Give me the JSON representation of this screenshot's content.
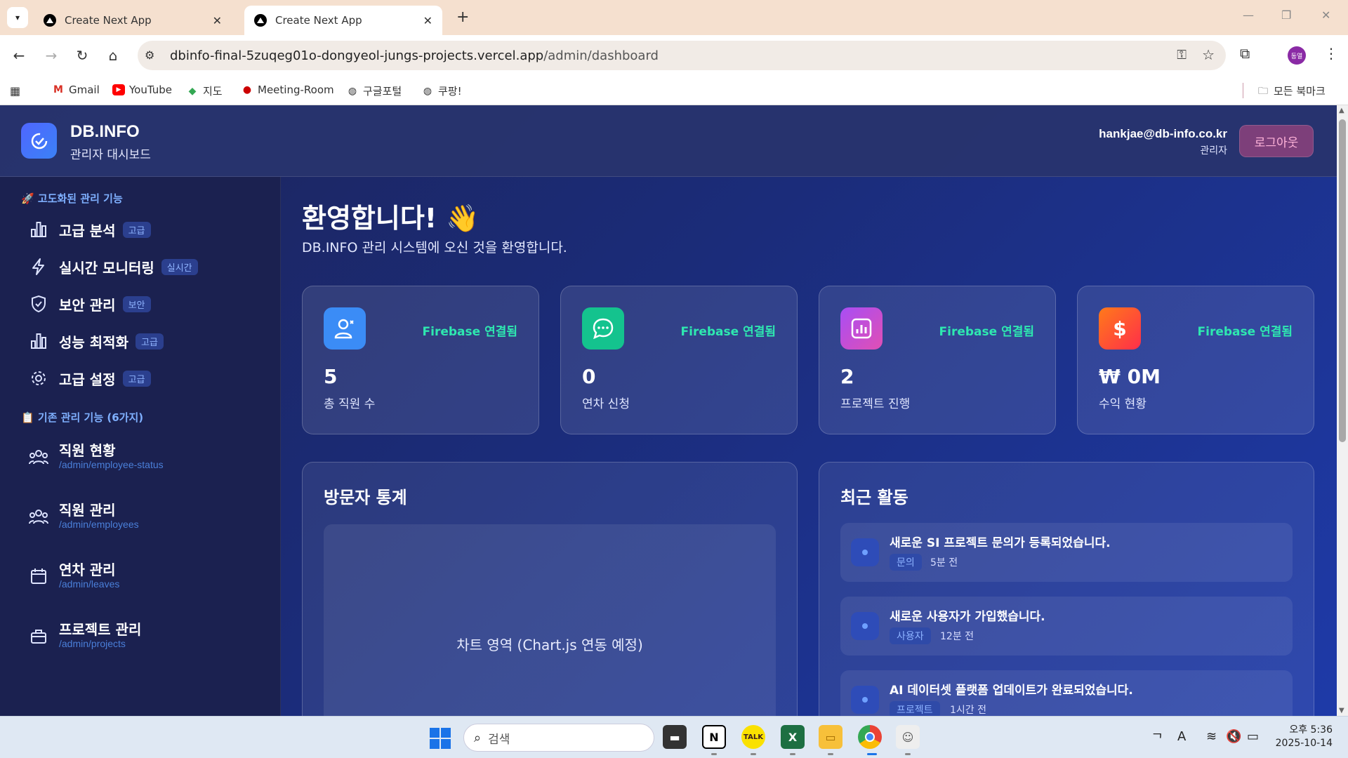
{
  "browser": {
    "tabs": [
      {
        "title": "Create Next App",
        "active": false
      },
      {
        "title": "Create Next App",
        "active": true
      }
    ],
    "url_host": "dbinfo-final-5zuqeg01o-dongyeol-jungs-projects.vercel.app",
    "url_path": "/admin/dashboard",
    "profile_initial": "동열",
    "bookmarks": [
      "Gmail",
      "YouTube",
      "지도",
      "Meeting-Room",
      "구글포털",
      "쿠팡!"
    ],
    "all_bookmarks": "모든 북마크"
  },
  "header": {
    "brand": "DB.INFO",
    "subtitle": "관리자 대시보드",
    "user_email": "hankjae@db-info.co.kr",
    "user_role": "관리자",
    "logout_label": "로그아웃"
  },
  "sidebar": {
    "advanced_title": "🚀 고도화된 관리 기능",
    "advanced_items": [
      {
        "label": "고급 분석",
        "badge": "고급",
        "icon": "bar-chart-icon"
      },
      {
        "label": "실시간 모니터링",
        "badge": "실시간",
        "icon": "lightning-icon"
      },
      {
        "label": "보안 관리",
        "badge": "보안",
        "icon": "shield-icon"
      },
      {
        "label": "성능 최적화",
        "badge": "고급",
        "icon": "bar-chart-icon"
      },
      {
        "label": "고급 설정",
        "badge": "고급",
        "icon": "gear-icon"
      }
    ],
    "basic_title": "📋 기존 관리 기능 (6가지)",
    "basic_items": [
      {
        "label": "직원 현황",
        "path": "/admin/employee-status",
        "icon": "users-icon"
      },
      {
        "label": "직원 관리",
        "path": "/admin/employees",
        "icon": "users-icon"
      },
      {
        "label": "연차 관리",
        "path": "/admin/leaves",
        "icon": "calendar-icon"
      },
      {
        "label": "프로젝트 관리",
        "path": "/admin/projects",
        "icon": "briefcase-icon"
      }
    ]
  },
  "main": {
    "welcome": "환영합니다! 👋",
    "welcome_sub": "DB.INFO 관리 시스템에 오신 것을 환영합니다.",
    "stats": [
      {
        "value": "5",
        "label": "총 직원 수",
        "status": "Firebase 연결됨",
        "icon": "user-icon",
        "color": "#3b8cf6"
      },
      {
        "value": "0",
        "label": "연차 신청",
        "status": "Firebase 연결됨",
        "icon": "chat-icon",
        "color": "#14c38e"
      },
      {
        "value": "2",
        "label": "프로젝트 진행",
        "status": "Firebase 연결됨",
        "icon": "bar-chart-icon",
        "color": "#b14cf0"
      },
      {
        "value": "₩ 0M",
        "label": "수익 현황",
        "status": "Firebase 연결됨",
        "icon": "dollar-icon",
        "color": "#ff5a2e"
      }
    ],
    "visitor_title": "방문자 통계",
    "chart_placeholder": "차트 영역 (Chart.js 연동 예정)",
    "activity_title": "최근 활동",
    "activities": [
      {
        "title": "새로운 SI 프로젝트 문의가 등록되었습니다.",
        "tag": "문의",
        "time": "5분 전"
      },
      {
        "title": "새로운 사용자가 가입했습니다.",
        "tag": "사용자",
        "time": "12분 전"
      },
      {
        "title": "AI 데이터셋 플랫폼 업데이트가 완료되었습니다.",
        "tag": "프로젝트",
        "time": "1시간 전"
      }
    ]
  },
  "taskbar": {
    "search_placeholder": "검색",
    "time": "오후 5:36",
    "date": "2025-10-14"
  }
}
